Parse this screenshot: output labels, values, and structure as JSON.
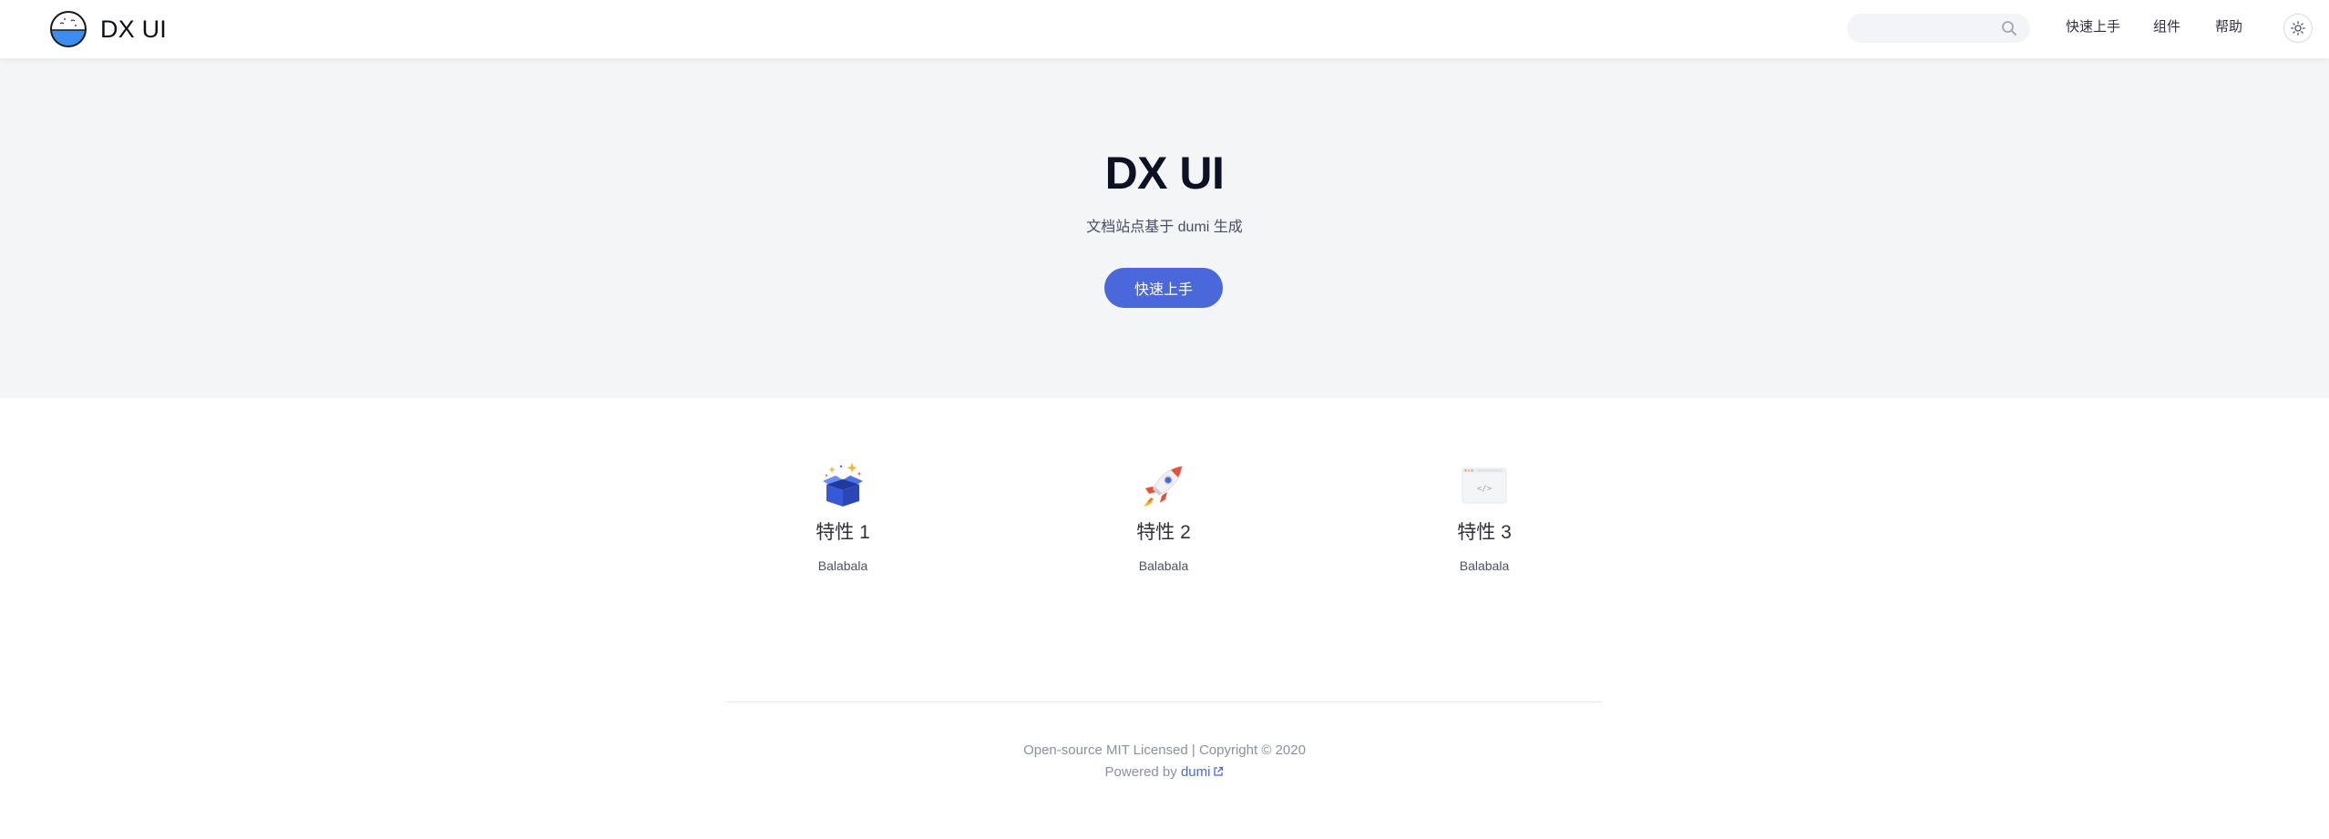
{
  "header": {
    "logo_text": "DX UI",
    "search": {
      "placeholder": "",
      "value": ""
    },
    "nav": [
      {
        "label": "快速上手"
      },
      {
        "label": "组件"
      },
      {
        "label": "帮助"
      }
    ],
    "theme_icon": "sun-icon"
  },
  "hero": {
    "title": "DX UI",
    "description": "文档站点基于 dumi 生成",
    "button_label": "快速上手"
  },
  "features": [
    {
      "icon": "gift-box-icon",
      "title": "特性 1",
      "description": "Balabala"
    },
    {
      "icon": "rocket-icon",
      "title": "特性 2",
      "description": "Balabala"
    },
    {
      "icon": "code-window-icon",
      "title": "特性 3",
      "description": "Balabala"
    }
  ],
  "footer": {
    "license": "Open-source MIT Licensed | Copyright © 2020",
    "powered_prefix": "Powered by ",
    "powered_link": "dumi"
  },
  "colors": {
    "accent": "#4a68d9",
    "hero_background": "#f4f5f7",
    "title": "#0d1124"
  }
}
